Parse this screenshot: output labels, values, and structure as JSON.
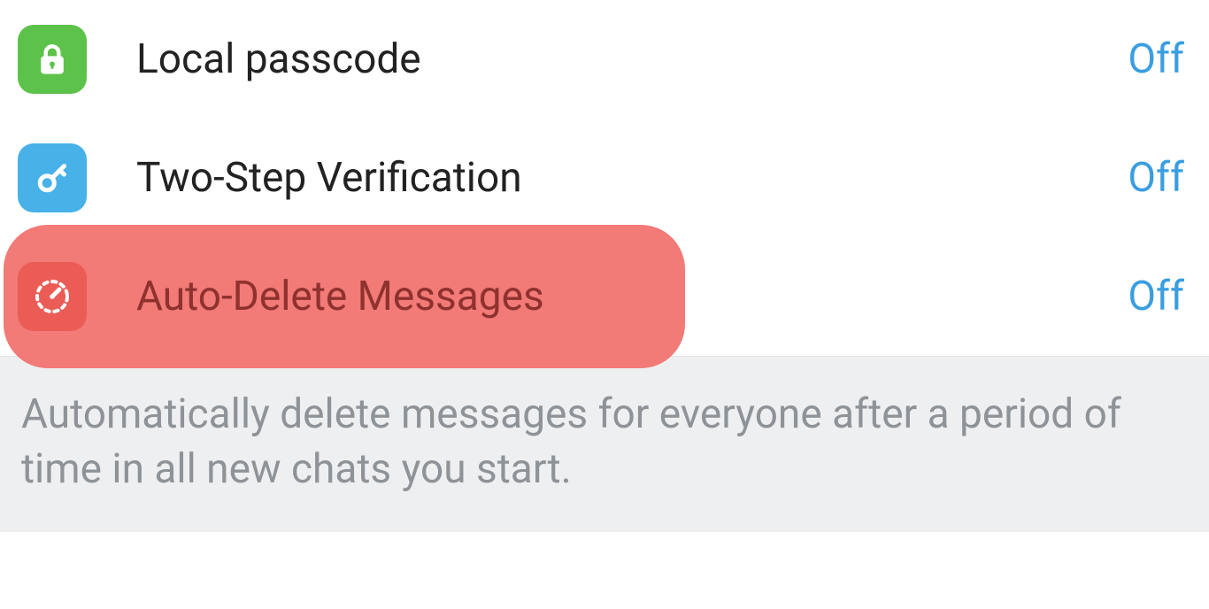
{
  "settings": {
    "items": [
      {
        "icon": "lock-icon",
        "label": "Local passcode",
        "value": "Off",
        "highlight": false
      },
      {
        "icon": "key-icon",
        "label": "Two-Step Verification",
        "value": "Off",
        "highlight": false
      },
      {
        "icon": "timer-icon",
        "label": "Auto-Delete Messages",
        "value": "Off",
        "highlight": true
      }
    ],
    "footer_note": "Automatically delete messages for everyone after a period of time in all new chats you start."
  },
  "colors": {
    "accent_blue": "#3a9ee0",
    "tile_green": "#5dc24a",
    "tile_blue": "#47b1e8",
    "tile_red": "#eb5c57",
    "highlight_pill": "#f27a77",
    "footer_bg": "#eeeff0",
    "footer_text": "#8e9398"
  }
}
